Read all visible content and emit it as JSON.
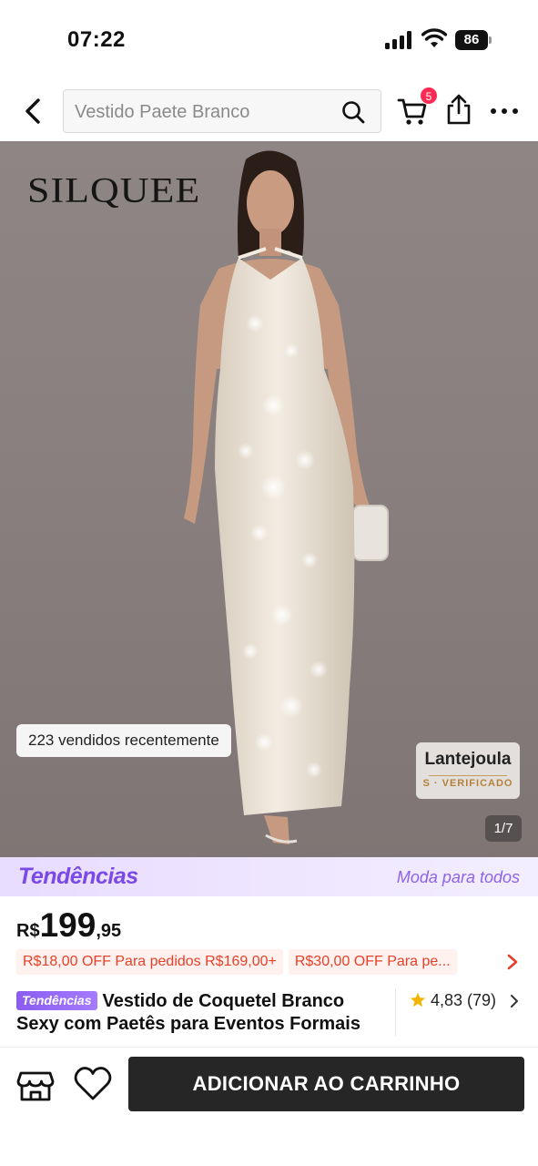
{
  "status_bar": {
    "time": "07:22",
    "battery": "86",
    "icons": [
      "signal-icon",
      "wifi-icon",
      "battery-icon"
    ]
  },
  "header": {
    "search_placeholder": "Vestido Paete Branco",
    "cart_badge": "5",
    "icons": [
      "back-arrow-icon",
      "search-icon",
      "cart-icon",
      "share-icon",
      "more-icon"
    ]
  },
  "hero": {
    "brand": "SILQUEE",
    "sold_text": "223 vendidos recentemente",
    "material_title": "Lantejoula",
    "material_sub": "S · VERIFICADO",
    "page_counter": "1/7"
  },
  "trend_banner": {
    "logo": "Tendências",
    "tagline": "Moda para todos"
  },
  "price": {
    "currency": "R$",
    "main": "199",
    "cents": ",95"
  },
  "coupons": [
    {
      "label": "R$18,00 OFF Para pedidos R$169,00+"
    },
    {
      "label": "R$30,00 OFF Para pe..."
    }
  ],
  "product": {
    "tag": "Tendências",
    "title": "Vestido de Coquetel Branco Sexy com Paetês para Eventos Formais",
    "rating": "4,83 (79)"
  },
  "bottom_bar": {
    "add_to_cart": "ADICIONAR AO CARRINHO",
    "icons": [
      "shop-icon",
      "heart-icon"
    ]
  },
  "colors": {
    "accent_dark": "#262626",
    "coupon_text": "#e5412a",
    "coupon_bg": "#fff1ee",
    "trend_purple": "#7a49e6",
    "badge_red": "#fe2c55",
    "star": "#f5b400"
  }
}
